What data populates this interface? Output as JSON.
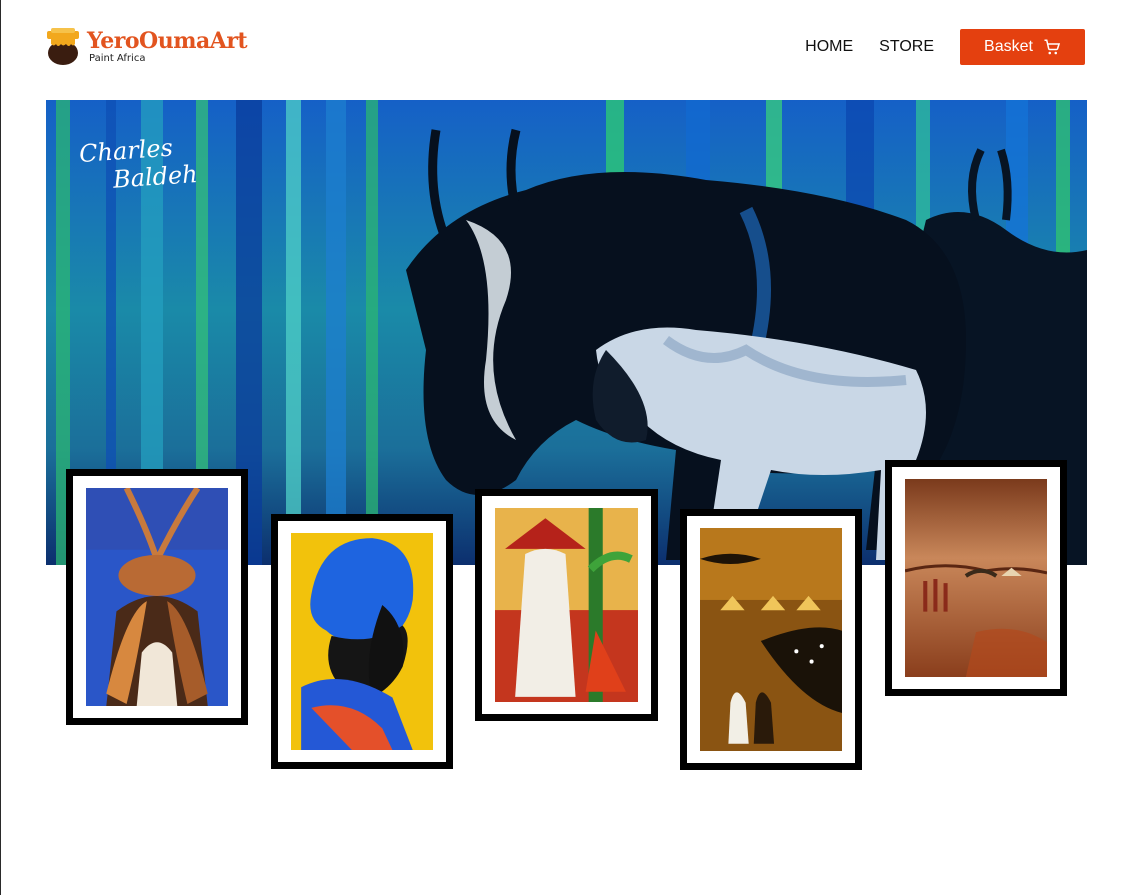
{
  "brand": {
    "title": "YeroOumaArt",
    "subtitle": "Paint Africa",
    "color": "#e2541f",
    "icon": "honey-pot-logo-icon"
  },
  "nav": {
    "items": [
      {
        "label": "HOME"
      },
      {
        "label": "STORE"
      }
    ],
    "basket_label": "Basket",
    "basket_icon": "cart-icon",
    "basket_color": "#e4400f"
  },
  "hero": {
    "signature_line1": "Charles",
    "signature_line2": "Baldeh",
    "image": "wildebeest-painting"
  },
  "gallery": {
    "items": [
      {
        "image": "women-carrying-baskets-painting"
      },
      {
        "image": "blue-headwrap-profile-painting"
      },
      {
        "image": "red-hat-figure-painting"
      },
      {
        "image": "village-walk-painting"
      },
      {
        "image": "sepia-landscape-painting"
      }
    ]
  }
}
